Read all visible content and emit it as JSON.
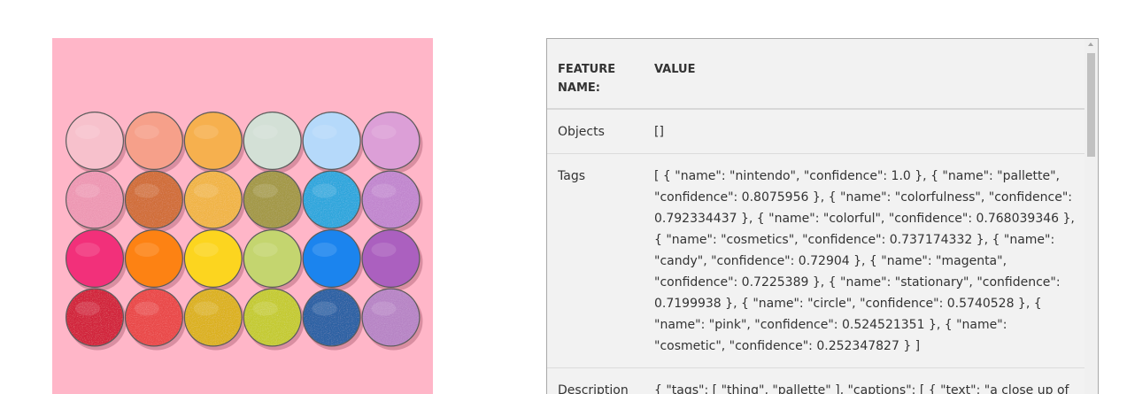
{
  "image": {
    "alt": "Colorful eyeshadow palette pans on pink background",
    "background_color": "#ffb6c8",
    "pans": [
      [
        "#f7c1cc",
        "#f6a08a",
        "#f6b04e",
        "#d3e0d6",
        "#b5d9fa",
        "#dc9fd7"
      ],
      [
        "#ef9ab5",
        "#d2703c",
        "#f2b64a",
        "#a59a4a",
        "#31a8de",
        "#c389d0"
      ],
      [
        "#f2307a",
        "#fd8213",
        "#fcd51f",
        "#c4d56f",
        "#1b84ee",
        "#ab60bf"
      ],
      [
        "#d3253e",
        "#eb4b4b",
        "#ddb322",
        "#c6cc35",
        "#2f63a5",
        "#b987c7"
      ]
    ],
    "shimmer_rows": [
      1,
      3
    ]
  },
  "table": {
    "headers": {
      "feature": "FEATURE NAME:",
      "value": "VALUE"
    },
    "rows": [
      {
        "feature": "Objects",
        "value": "[]"
      },
      {
        "feature": "Tags",
        "value": "[ { \"name\": \"nintendo\", \"confidence\": 1.0 }, { \"name\": \"pallette\", \"confidence\": 0.8075956 }, { \"name\": \"colorfulness\", \"confidence\": 0.792334437 }, { \"name\": \"colorful\", \"confidence\": 0.768039346 }, { \"name\": \"cosmetics\", \"confidence\": 0.737174332 }, { \"name\": \"candy\", \"confidence\": 0.72904 }, { \"name\": \"magenta\", \"confidence\": 0.7225389 }, { \"name\": \"stationary\", \"confidence\": 0.7199938 }, { \"name\": \"circle\", \"confidence\": 0.5740528 }, { \"name\": \"pink\", \"confidence\": 0.524521351 }, { \"name\": \"cosmetic\", \"confidence\": 0.252347827 } ]"
      },
      {
        "feature": "Description",
        "value": "{ \"tags\": [ \"thing\", \"pallette\" ], \"captions\": [ { \"text\": \"a close up of"
      }
    ]
  }
}
